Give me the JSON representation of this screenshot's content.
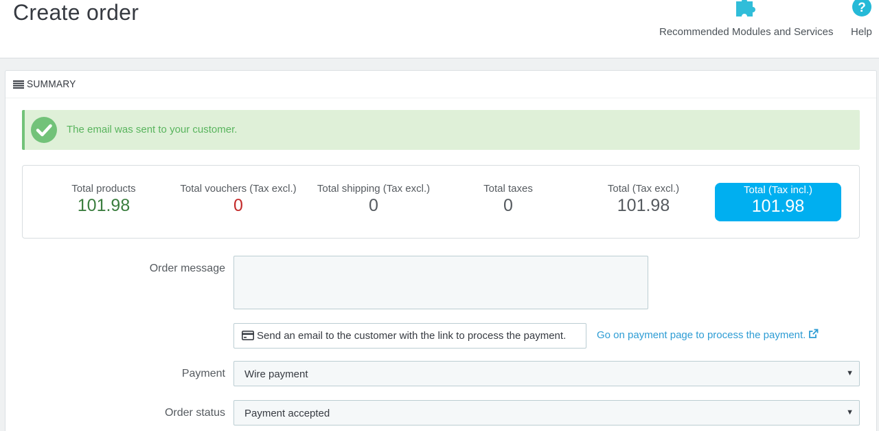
{
  "header": {
    "title": "Create order",
    "toolbar": {
      "modules_label": "Recommended Modules and Services",
      "help_label": "Help"
    }
  },
  "panel": {
    "heading": "SUMMARY",
    "alert": "The email was sent to your customer.",
    "totals": [
      {
        "label": "Total products",
        "value": "101.98"
      },
      {
        "label": "Total vouchers (Tax excl.)",
        "value": "0"
      },
      {
        "label": "Total shipping (Tax excl.)",
        "value": "0"
      },
      {
        "label": "Total taxes",
        "value": "0"
      },
      {
        "label": "Total (Tax excl.)",
        "value": "101.98"
      },
      {
        "label": "Total (Tax incl.)",
        "value": "101.98"
      }
    ],
    "order_message_label": "Order message",
    "order_message_value": "",
    "send_email_button": "Send an email to the customer with the link to process the payment.",
    "payment_page_link": "Go on payment page to process the payment.",
    "payment_label": "Payment",
    "payment_value": "Wire payment",
    "order_status_label": "Order status",
    "order_status_value": "Payment accepted"
  },
  "colors": {
    "accent": "#00aff0",
    "success_bg": "#dff0d8",
    "success_text": "#58b45d",
    "link": "#2d9cd4",
    "negative": "#c32a2a",
    "positive": "#3a7d3e"
  },
  "icons": {
    "modules": "puzzle-icon",
    "help": "question-circle-icon",
    "heading": "list-icon",
    "alert": "check-circle-icon",
    "email_button": "credit-card-icon",
    "payment_link": "external-link-icon"
  }
}
